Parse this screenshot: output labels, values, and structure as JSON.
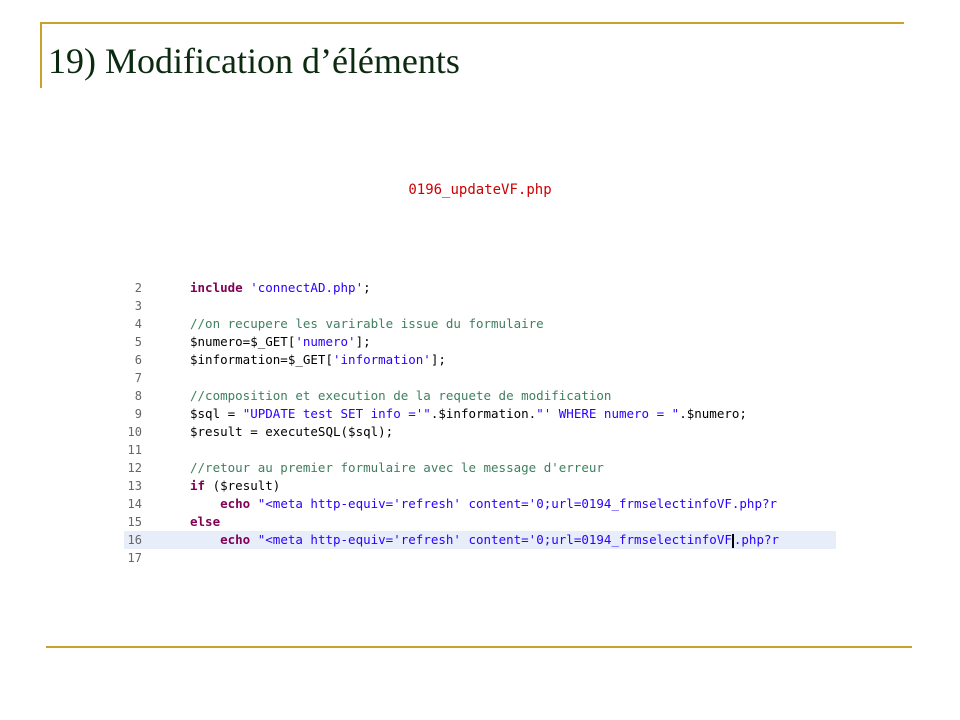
{
  "slide": {
    "title": "19) Modification d’éléments",
    "filename": "0196_updateVF.php"
  },
  "code": {
    "language": "php",
    "highlighted_line": 16,
    "lines": [
      {
        "num": "2",
        "tokens": [
          {
            "t": "kw",
            "v": "include"
          },
          {
            "t": "plain",
            "v": " "
          },
          {
            "t": "str",
            "v": "'connectAD.php'"
          },
          {
            "t": "plain",
            "v": ";"
          }
        ]
      },
      {
        "num": "3",
        "tokens": []
      },
      {
        "num": "4",
        "tokens": [
          {
            "t": "comment",
            "v": "//on recupere les varirable issue du formulaire"
          }
        ]
      },
      {
        "num": "5",
        "tokens": [
          {
            "t": "plain",
            "v": "$numero=$_GET["
          },
          {
            "t": "str",
            "v": "'numero'"
          },
          {
            "t": "plain",
            "v": "];"
          }
        ]
      },
      {
        "num": "6",
        "tokens": [
          {
            "t": "plain",
            "v": "$information=$_GET["
          },
          {
            "t": "str",
            "v": "'information'"
          },
          {
            "t": "plain",
            "v": "];"
          }
        ]
      },
      {
        "num": "7",
        "tokens": []
      },
      {
        "num": "8",
        "tokens": [
          {
            "t": "comment",
            "v": "//composition et execution de la requete de modification"
          }
        ]
      },
      {
        "num": "9",
        "tokens": [
          {
            "t": "plain",
            "v": "$sql = "
          },
          {
            "t": "str",
            "v": "\"UPDATE test SET info ='\""
          },
          {
            "t": "plain",
            "v": ".$information."
          },
          {
            "t": "str",
            "v": "\"' WHERE numero = \""
          },
          {
            "t": "plain",
            "v": ".$numero;"
          }
        ]
      },
      {
        "num": "10",
        "tokens": [
          {
            "t": "plain",
            "v": "$result = executeSQL($sql);"
          }
        ]
      },
      {
        "num": "11",
        "tokens": []
      },
      {
        "num": "12",
        "tokens": [
          {
            "t": "comment",
            "v": "//retour au premier formulaire avec le message d'erreur"
          }
        ]
      },
      {
        "num": "13",
        "tokens": [
          {
            "t": "kw",
            "v": "if"
          },
          {
            "t": "plain",
            "v": " ($result)"
          }
        ]
      },
      {
        "num": "14",
        "tokens": [
          {
            "t": "plain",
            "v": "    "
          },
          {
            "t": "kw",
            "v": "echo"
          },
          {
            "t": "plain",
            "v": " "
          },
          {
            "t": "str",
            "v": "\"<meta http-equiv='refresh' content='0;url=0194_frmselectinfoVF.php?r"
          }
        ]
      },
      {
        "num": "15",
        "tokens": [
          {
            "t": "kw",
            "v": "else"
          }
        ]
      },
      {
        "num": "16",
        "tokens": [
          {
            "t": "plain",
            "v": "    "
          },
          {
            "t": "kw",
            "v": "echo"
          },
          {
            "t": "plain",
            "v": " "
          },
          {
            "t": "str",
            "v": "\"<meta http-equiv='refresh' content='0;url=0194_frmselectinfoVF"
          },
          {
            "t": "caret",
            "v": ""
          },
          {
            "t": "str",
            "v": ".php?r"
          }
        ]
      },
      {
        "num": "17",
        "tokens": []
      }
    ]
  }
}
